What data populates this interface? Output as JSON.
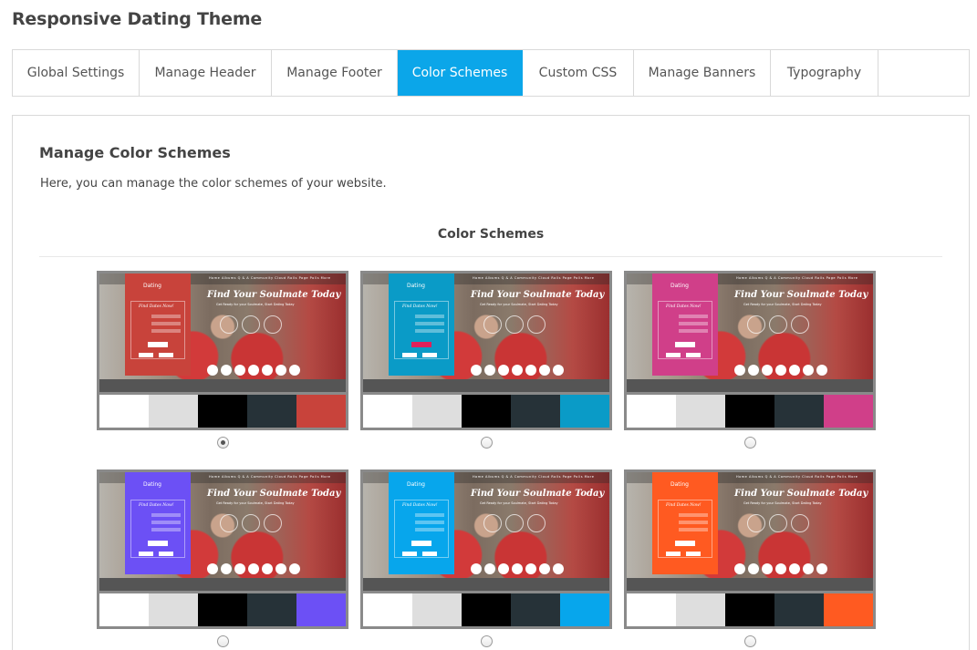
{
  "page_title": "Responsive Dating Theme",
  "tabs": [
    {
      "label": "Global Settings"
    },
    {
      "label": "Manage Header"
    },
    {
      "label": "Manage Footer"
    },
    {
      "label": "Color Schemes"
    },
    {
      "label": "Custom CSS"
    },
    {
      "label": "Manage Banners"
    },
    {
      "label": "Typography"
    }
  ],
  "active_tab": "Color Schemes",
  "panel": {
    "heading": "Manage Color Schemes",
    "description": "Here, you can manage the color schemes of your website.",
    "section_title": "Color Schemes"
  },
  "preview_text": {
    "logo": "Dating",
    "hero": "Find Your Soulmate Today",
    "sub": "Get Ready for your Soulmate, Start Dating Today",
    "form_title": "Find Dates Now!",
    "nav": "Home  Albums  Q & A  Community  Cloud Rolls  Page Polls  More"
  },
  "colors": {
    "accent": "#0ba6e9",
    "swatch_white": "#ffffff",
    "swatch_light_gray": "#dedede",
    "swatch_black": "#000000",
    "swatch_charcoal": "#263238"
  },
  "schemes": [
    {
      "accent": "#c8433b",
      "selected": true
    },
    {
      "accent": "#0a9bc7",
      "selected": false
    },
    {
      "accent": "#d03f89",
      "selected": false
    },
    {
      "accent": "#6c50f5",
      "selected": false
    },
    {
      "accent": "#07a6ec",
      "selected": false
    },
    {
      "accent": "#ff5a21",
      "selected": false
    }
  ]
}
